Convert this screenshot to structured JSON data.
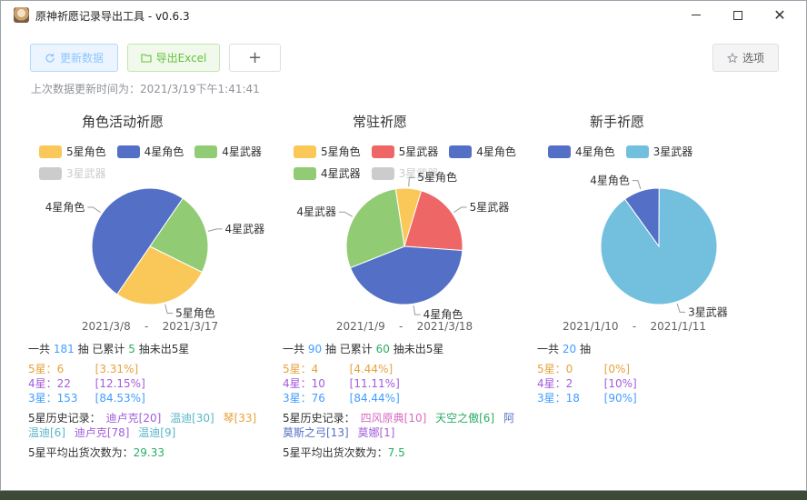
{
  "window": {
    "title": "原神祈愿记录导出工具 - v0.6.3"
  },
  "toolbar": {
    "refresh_label": "更新数据",
    "export_label": "导出Excel",
    "add_label": "+",
    "options_label": "选项"
  },
  "last_update": "上次数据更新时间为：2021/3/19下午1:41:41",
  "labels": {
    "total_prefix": "一共",
    "total_suffix": "抽",
    "since_prefix": "已累计",
    "since_suffix": "抽未出5星",
    "history_prefix": "5星历史记录：",
    "avg_prefix": "5星平均出货次数为：",
    "date_sep": "-"
  },
  "colors": {
    "five_char": "#fac858",
    "four_char": "#5470c6",
    "four_weapon": "#91cc75",
    "three_weapon": "#73c0de",
    "five_weapon": "#ee6666",
    "disabled": "#cccccc"
  },
  "panels": [
    {
      "title": "角色活动祈愿",
      "legend": [
        {
          "name": "5星角色",
          "color": "#fac858",
          "enabled": true
        },
        {
          "name": "4星角色",
          "color": "#5470c6",
          "enabled": true
        },
        {
          "name": "4星武器",
          "color": "#91cc75",
          "enabled": true
        },
        {
          "name": "3星武器",
          "color": "#cccccc",
          "enabled": false
        }
      ],
      "slices": [
        {
          "name": "5星角色",
          "value": 6,
          "color": "#fac858"
        },
        {
          "name": "4星角色",
          "value": 11,
          "color": "#5470c6"
        },
        {
          "name": "4星武器",
          "value": 5,
          "color": "#91cc75"
        }
      ],
      "date_start": "2021/3/8",
      "date_end": "2021/3/17",
      "total": "181",
      "since": "5",
      "rows": [
        {
          "label": "5星：",
          "count": "6",
          "pct": "[3.31%]",
          "cls": "c5"
        },
        {
          "label": "4星：",
          "count": "22",
          "pct": "[12.15%]",
          "cls": "c4"
        },
        {
          "label": "3星：",
          "count": "153",
          "pct": "[84.53%]",
          "cls": "c3"
        }
      ],
      "history": [
        {
          "text": "迪卢克[20]",
          "color": "#a25cdc"
        },
        {
          "text": "温迪[30]",
          "color": "#57b6c9"
        },
        {
          "text": "琴[33]",
          "color": "#e6a23c"
        },
        {
          "text": "温迪[6]",
          "color": "#57b6c9"
        },
        {
          "text": "迪卢克[78]",
          "color": "#a25cdc"
        },
        {
          "text": "温迪[9]",
          "color": "#57b6c9"
        }
      ],
      "avg": "29.33"
    },
    {
      "title": "常驻祈愿",
      "legend": [
        {
          "name": "5星角色",
          "color": "#fac858",
          "enabled": true
        },
        {
          "name": "5星武器",
          "color": "#ee6666",
          "enabled": true
        },
        {
          "name": "4星角色",
          "color": "#5470c6",
          "enabled": true
        },
        {
          "name": "4星武器",
          "color": "#91cc75",
          "enabled": true
        },
        {
          "name": "3星武器",
          "color": "#cccccc",
          "enabled": false
        }
      ],
      "slices": [
        {
          "name": "5星角色",
          "value": 1,
          "color": "#fac858"
        },
        {
          "name": "5星武器",
          "value": 3,
          "color": "#ee6666"
        },
        {
          "name": "4星角色",
          "value": 6,
          "color": "#5470c6"
        },
        {
          "name": "4星武器",
          "value": 4,
          "color": "#91cc75"
        }
      ],
      "date_start": "2021/1/9",
      "date_end": "2021/3/18",
      "total": "90",
      "since": "60",
      "rows": [
        {
          "label": "5星：",
          "count": "4",
          "pct": "[4.44%]",
          "cls": "c5"
        },
        {
          "label": "4星：",
          "count": "10",
          "pct": "[11.11%]",
          "cls": "c4"
        },
        {
          "label": "3星：",
          "count": "76",
          "pct": "[84.44%]",
          "cls": "c3"
        }
      ],
      "history": [
        {
          "text": "四风原典[10]",
          "color": "#d96ac2"
        },
        {
          "text": "天空之傲[6]",
          "color": "#2bac67"
        },
        {
          "text": "阿莫斯之弓[13]",
          "color": "#5470c6"
        },
        {
          "text": "莫娜[1]",
          "color": "#a25cdc"
        }
      ],
      "avg": "7.5"
    },
    {
      "title": "新手祈愿",
      "legend": [
        {
          "name": "4星角色",
          "color": "#5470c6",
          "enabled": true
        },
        {
          "name": "3星武器",
          "color": "#73c0de",
          "enabled": true
        }
      ],
      "slices": [
        {
          "name": "4星角色",
          "value": 2,
          "color": "#5470c6"
        },
        {
          "name": "3星武器",
          "value": 18,
          "color": "#73c0de"
        }
      ],
      "date_start": "2021/1/10",
      "date_end": "2021/1/11",
      "total": "20",
      "rows": [
        {
          "label": "5星：",
          "count": "0",
          "pct": "[0%]",
          "cls": "c5"
        },
        {
          "label": "4星：",
          "count": "2",
          "pct": "[10%]",
          "cls": "c4"
        },
        {
          "label": "3星：",
          "count": "18",
          "pct": "[90%]",
          "cls": "c3"
        }
      ]
    }
  ]
}
